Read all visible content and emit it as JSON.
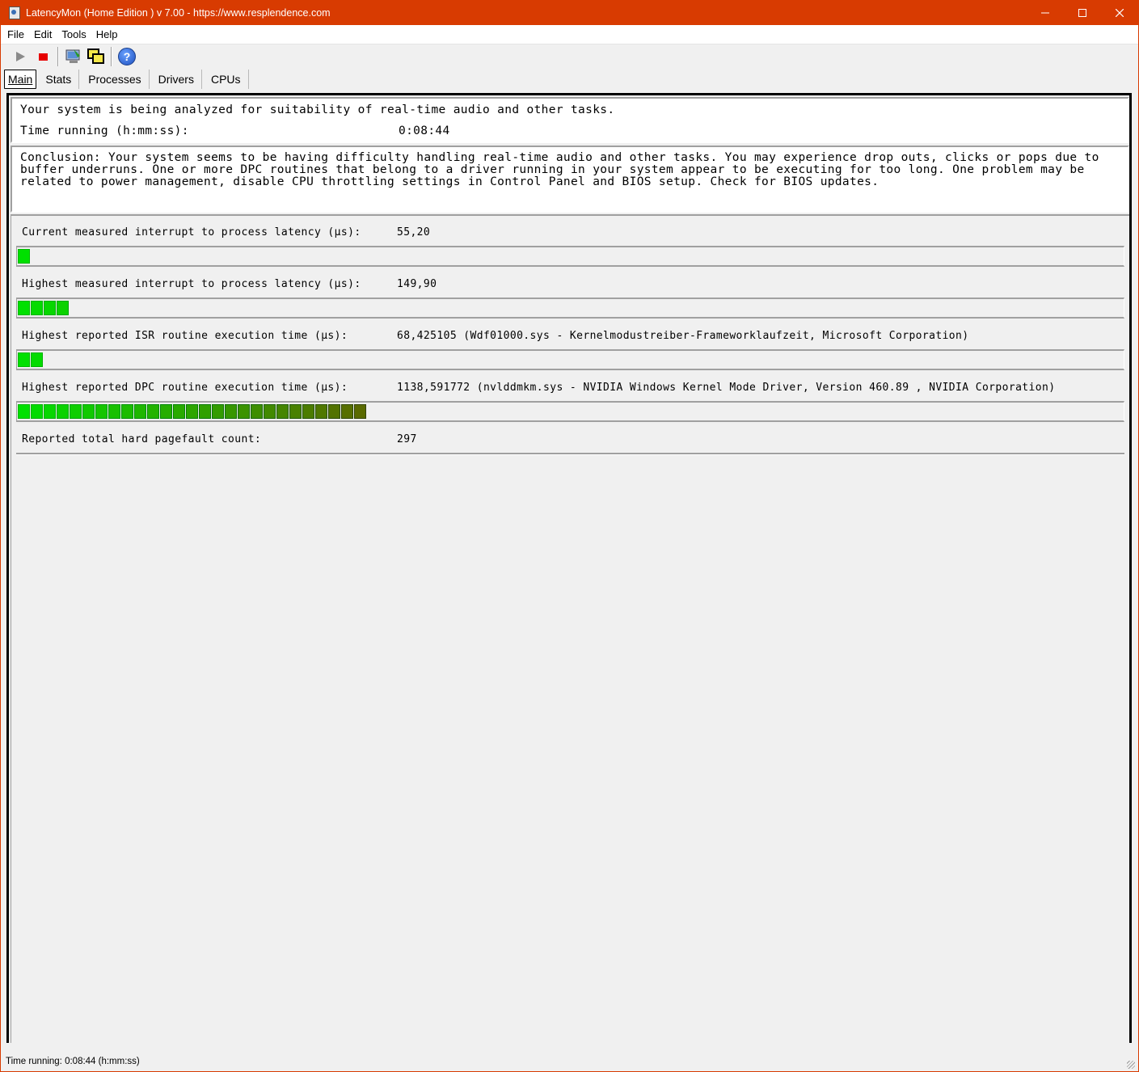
{
  "window": {
    "title": "LatencyMon  (Home Edition )  v 7.00 - https://www.resplendence.com",
    "minimize": "—",
    "maximize": "☐",
    "close": "✕"
  },
  "menu": {
    "file": "File",
    "edit": "Edit",
    "tools": "Tools",
    "help": "Help"
  },
  "toolbar": {
    "icons": [
      "play-icon",
      "stop-icon",
      "analyze-icon",
      "windows-icon",
      "help-icon"
    ]
  },
  "tabs": {
    "main": "Main",
    "stats": "Stats",
    "processes": "Processes",
    "drivers": "Drivers",
    "cpus": "CPUs",
    "active": "Main"
  },
  "header": {
    "status": "Your system is being analyzed for suitability of real-time audio and other tasks.",
    "time_label": "Time running (h:mm:ss):",
    "time_value": "0:08:44"
  },
  "conclusion": {
    "text": "Conclusion: Your system seems to be having difficulty handling real-time audio and other tasks. You may experience drop outs, clicks or pops due to\nbuffer underruns. One or more DPC routines that belong to a driver running in your system appear to be executing for too long. One problem may be\nrelated to power management, disable CPU throttling settings in Control Panel and BIOS setup. Check for BIOS updates."
  },
  "stats": {
    "current_latency": {
      "label": "Current measured interrupt to process latency (µs):",
      "value": "55,20",
      "level_segments": 1
    },
    "highest_latency": {
      "label": "Highest measured interrupt to process latency (µs):",
      "value": "149,90",
      "level_segments": 4
    },
    "isr": {
      "label": "Highest reported ISR routine execution time (µs):",
      "value": "68,425105   (Wdf01000.sys - Kernelmodustreiber-Frameworklaufzeit, Microsoft Corporation)",
      "level_segments": 2
    },
    "dpc": {
      "label": "Highest reported DPC routine execution time (µs):",
      "value": "1138,591772   (nvlddmkm.sys - NVIDIA Windows Kernel Mode Driver, Version 460.89 , NVIDIA Corporation)",
      "level_segments": 27
    },
    "pagefault": {
      "label": "Reported total hard pagefault count:",
      "value": "297"
    }
  },
  "statusbar": {
    "text": "Time running: 0:08:44  (h:mm:ss)"
  },
  "colors": {
    "titlebar": "#d83b01",
    "bar_green_start": "#00e000",
    "bar_green_end": "#5a6a00"
  }
}
